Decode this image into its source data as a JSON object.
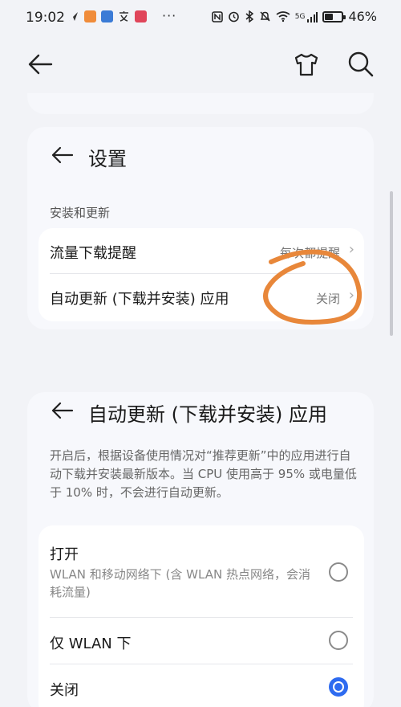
{
  "status_bar": {
    "time": "19:02",
    "dots": "···",
    "network": "5G",
    "battery_percent": 46,
    "battery_text": "46%"
  },
  "topbar": {
    "back_icon": "arrow-left-icon",
    "theme_icon": "tshirt-icon",
    "search_icon": "search-icon"
  },
  "settings_panel": {
    "title": "设置",
    "section": "安装和更新",
    "rows": [
      {
        "label": "流量下载提醒",
        "value": "每次都提醒"
      },
      {
        "label": "自动更新 (下载并安装) 应用",
        "value": "关闭"
      }
    ]
  },
  "auto_update_panel": {
    "title": "自动更新 (下载并安装) 应用",
    "description": "开启后，根据设备使用情况对“推荐更新”中的应用进行自动下载并安装最新版本。当 CPU 使用高于 95% 或电量低于 10% 时，不会进行自动更新。",
    "options": [
      {
        "label": "打开",
        "sub": "WLAN 和移动网络下 (含 WLAN 热点网络，会消耗流量)",
        "selected": false
      },
      {
        "label": "仅 WLAN 下",
        "sub": "",
        "selected": false
      },
      {
        "label": "关闭",
        "sub": "",
        "selected": true
      }
    ]
  },
  "colors": {
    "accent": "#2e6bf0",
    "annotation": "#e8873a",
    "background": "#f2f3f7"
  }
}
